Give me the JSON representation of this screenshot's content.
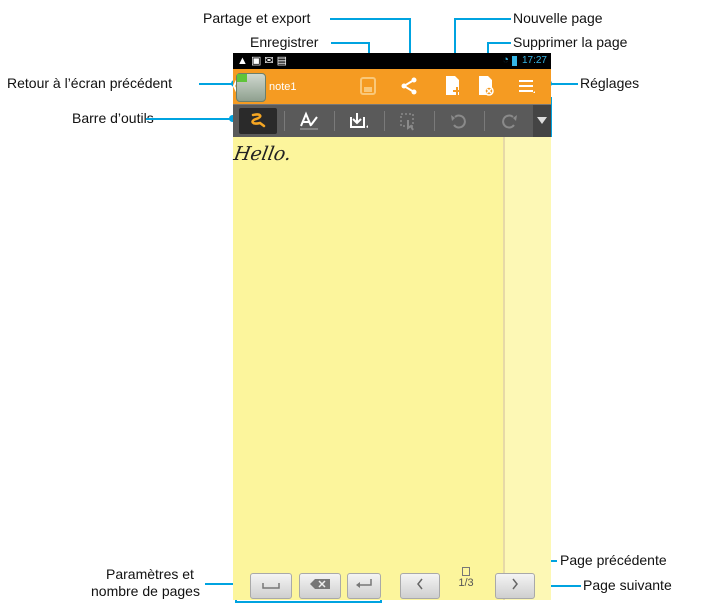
{
  "status_bar": {
    "left_icons": "▲ ▣ ✉ ▤",
    "time": "17:27"
  },
  "action_bar": {
    "note_title": "note1"
  },
  "callouts": {
    "partage": "Partage et export",
    "enregistrer": "Enregistrer",
    "nouvelle_page": "Nouvelle page",
    "supprimer_page": "Supprimer la page",
    "retour": "Retour à l’écran précédent",
    "reglages": "Réglages",
    "barre_outils": "Barre d’outils",
    "page_precedente": "Page précédente",
    "page_suivante": "Page suivante",
    "parametres_line1": "Paramètres et",
    "parametres_line2": "nombre de pages"
  },
  "note": {
    "handwriting": "Hello."
  },
  "bottom_bar": {
    "page_counter": "1/3"
  },
  "colors": {
    "accent": "#f59b22",
    "callout": "#00a3e0",
    "paper": "#fcf59c",
    "toolbar": "#5a5a5a",
    "highlight_pen": "#f5a623"
  },
  "icons": [
    "back-arrow-icon",
    "notebook-icon",
    "save-icon",
    "share-icon",
    "new-page-icon",
    "delete-page-icon",
    "settings-menu-icon",
    "pen-icon",
    "text-mode-icon",
    "insert-icon",
    "selection-icon",
    "undo-icon",
    "redo-icon",
    "dropdown-triangle-icon",
    "space-icon",
    "backspace-icon",
    "enter-icon",
    "previous-page-icon",
    "page-indicator-icon",
    "next-page-icon"
  ]
}
